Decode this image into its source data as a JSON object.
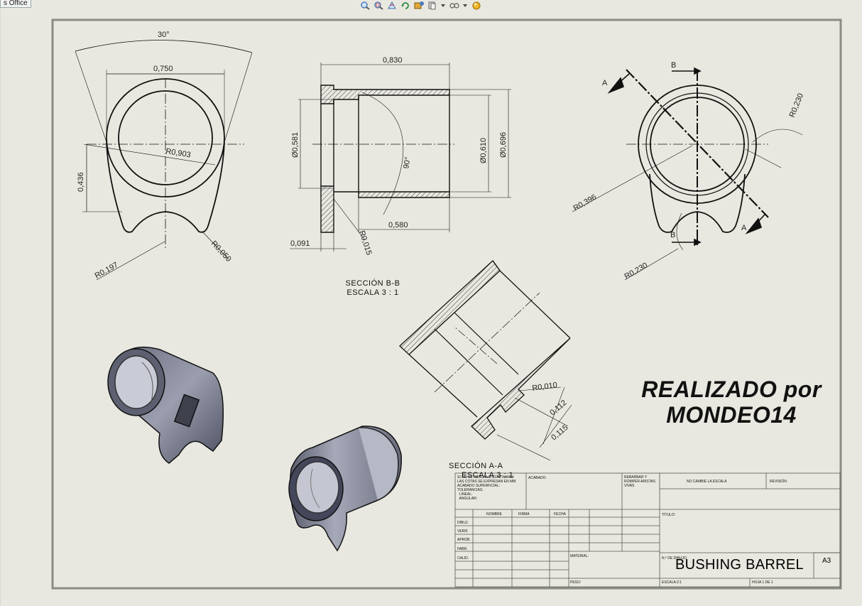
{
  "window": {
    "office_tab": "s Office"
  },
  "toolbar": {
    "icons": [
      "zoom-to-fit-icon",
      "zoom-area-icon",
      "previous-view-icon",
      "rebuild-icon",
      "view-settings-icon",
      "display-style-icon",
      "hide-show-icon",
      "appearance-icon"
    ]
  },
  "drawing": {
    "front_view": {
      "angle": "30°",
      "width": "0,750",
      "height": "0,436",
      "outer_radius": "R0,903",
      "notch_radius": "R0,197",
      "fillet_radius": "R0,050"
    },
    "section_bb": {
      "overall_length": "0,830",
      "inner_diameter": "Ø0,581",
      "bore_diameter": "Ø0,610",
      "outer_diameter": "Ø0,696",
      "angle": "90°",
      "body_length": "0,580",
      "flange_thickness": "0,091",
      "fillet_radius": "R0,015",
      "label_line1": "SECCIÓN B-B",
      "label_line2": "ESCALA 3 : 1"
    },
    "side_view": {
      "radius_1": "R0,230",
      "radius_2": "R0,396",
      "radius_3": "R0,230",
      "section_a": "A",
      "section_b": "B"
    },
    "section_aa": {
      "fillet_radius": "R0,010",
      "dim_1": "0,112",
      "dim_2": "0,115",
      "label_line1": "SECCIÓN A-A",
      "label_line2": "ESCALA 3 : 1"
    },
    "credit_line1": "REALIZADO por",
    "credit_line2": "MONDEO14"
  },
  "title_block": {
    "notes": "SI NO SE INDICA LO CONTRARIO:\nLAS COTAS SE EXPRESAN EN MM\nACABADO SUPERFICIAL:\nTOLERANCIAS:\n  LINEAL:\n  ANGULAR:",
    "finish": "ACABADO:",
    "edges": "REBARBAR Y\nROMPER ARISTAS\nVIVAS",
    "no_scale": "NO CAMBIE LA ESCALA",
    "revision": "REVISIÓN",
    "col_name": "NOMBRE",
    "col_sign": "FIRMA",
    "col_date": "FECHA",
    "row_drawn": "DIBUJ.",
    "row_verified": "VERIF.",
    "row_approved": "APROB.",
    "row_manuf": "FABR.",
    "row_quality": "CALID.",
    "title_label": "TÍTULO:",
    "material": "MATERIAL:",
    "drawing_no_label": "N.º DE DIBUJO",
    "part_name": "BUSHING BARREL",
    "sheet_size": "A3",
    "weight": "PESO:",
    "scale": "ESCALA:2:1",
    "sheet": "HOJA 1 DE 1"
  }
}
